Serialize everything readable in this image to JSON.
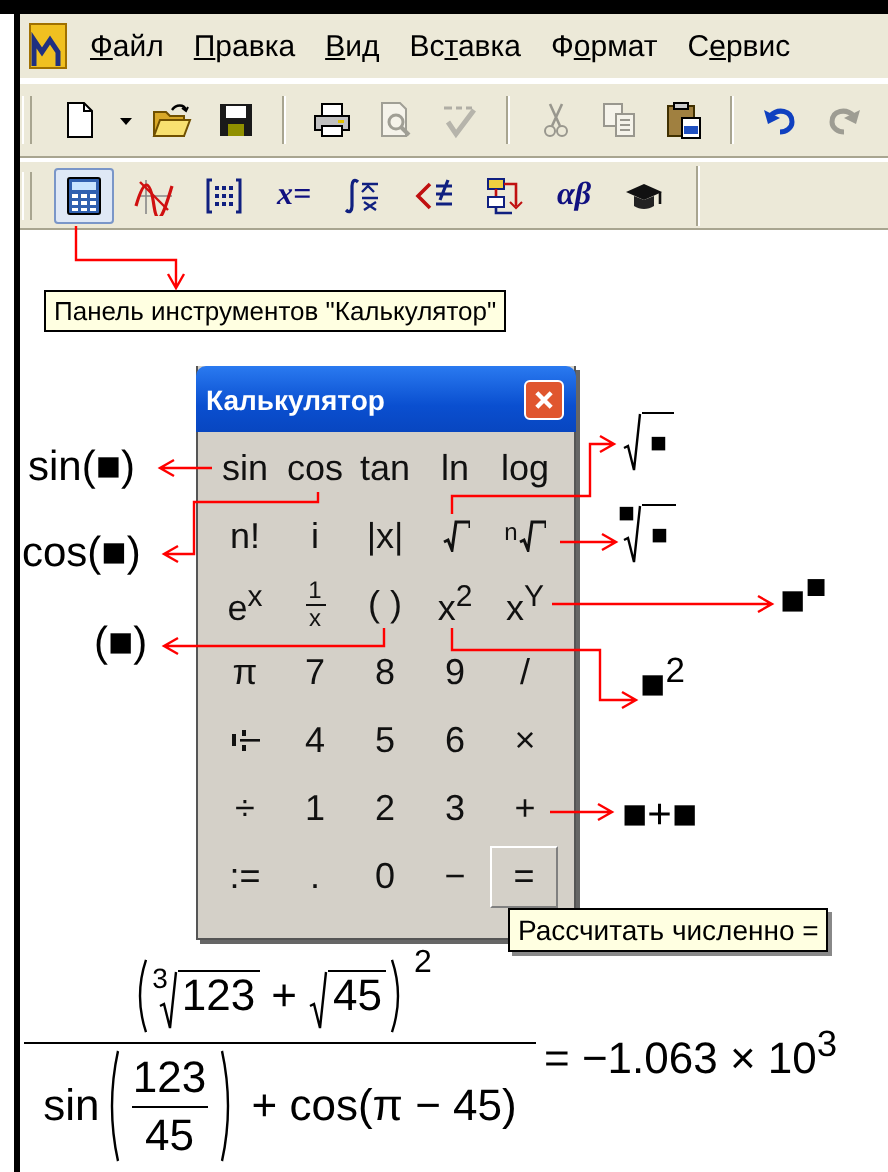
{
  "menu_bar": [
    {
      "mnemonic": "Ф",
      "suffix": "айл"
    },
    {
      "mnemonic": "П",
      "suffix": "равка"
    },
    {
      "mnemonic": "В",
      "suffix": "ид"
    },
    {
      "prefix": "Вс",
      "mnemonic": "т",
      "suffix": "авка"
    },
    {
      "prefix": "Ф",
      "mnemonic": "о",
      "suffix": "рмат"
    },
    {
      "prefix": "С",
      "mnemonic": "е",
      "suffix": "рвис"
    }
  ],
  "standard_toolbar": [
    {
      "kind": "button",
      "disabled": false
    },
    {
      "kind": "button",
      "disabled": false
    },
    {
      "kind": "button",
      "disabled": false
    },
    {
      "kind": "button",
      "disabled": false
    },
    {
      "kind": "separator"
    },
    {
      "kind": "button",
      "disabled": false
    },
    {
      "kind": "button",
      "disabled": true
    },
    {
      "kind": "button",
      "disabled": true
    },
    {
      "kind": "separator"
    },
    {
      "kind": "button",
      "disabled": true
    },
    {
      "kind": "button",
      "disabled": true
    },
    {
      "kind": "button",
      "disabled": false
    },
    {
      "kind": "separator"
    },
    {
      "kind": "button",
      "disabled": false
    },
    {
      "kind": "button",
      "disabled": true
    }
  ],
  "math_toolbar": [
    {
      "kind": "icon",
      "selected": true
    },
    {
      "kind": "icon",
      "selected": false
    },
    {
      "kind": "icon",
      "selected": false
    },
    {
      "kind": "text",
      "label": "x=",
      "selected": false
    },
    {
      "kind": "icon",
      "selected": false
    },
    {
      "kind": "icon",
      "selected": false
    },
    {
      "kind": "icon",
      "selected": false
    },
    {
      "kind": "text",
      "label": "αβ",
      "selected": false
    },
    {
      "kind": "icon",
      "selected": false
    }
  ],
  "toolbar_tooltip": "Панель инструментов \"Калькулятор\"",
  "calculator": {
    "title": "Калькулятор",
    "rows": [
      [
        {
          "kind": "text",
          "label": "sin",
          "hovered": false
        },
        {
          "kind": "text",
          "label": "cos",
          "hovered": false
        },
        {
          "kind": "text",
          "label": "tan",
          "hovered": false
        },
        {
          "kind": "text",
          "label": "ln",
          "hovered": false
        },
        {
          "kind": "text",
          "label": "log",
          "hovered": false
        }
      ],
      [
        {
          "kind": "text",
          "label": "n!",
          "hovered": false
        },
        {
          "kind": "text",
          "label": "i",
          "hovered": false
        },
        {
          "kind": "text",
          "label": "|x|",
          "hovered": false
        },
        {
          "kind": "root",
          "hovered": false
        },
        {
          "kind": "root",
          "index": "n",
          "hovered": false
        }
      ],
      [
        {
          "kind": "text",
          "label": "e$^{x}$",
          "hovered": false
        },
        {
          "kind": "fraction",
          "numerator": "1",
          "denominator": "x",
          "hovered": false
        },
        {
          "kind": "text",
          "label": "( )",
          "hovered": false
        },
        {
          "kind": "text",
          "label": "x$^{2}$",
          "hovered": false
        },
        {
          "kind": "text",
          "label": "x$^{Y}$",
          "hovered": false
        }
      ],
      [
        {
          "kind": "text",
          "label": "π",
          "hovered": false
        },
        {
          "kind": "text",
          "label": "7",
          "hovered": false
        },
        {
          "kind": "text",
          "label": "8",
          "hovered": false
        },
        {
          "kind": "text",
          "label": "9",
          "hovered": false
        },
        {
          "kind": "text",
          "label": "/",
          "hovered": false
        }
      ],
      [
        {
          "kind": "mixed",
          "hovered": false
        },
        {
          "kind": "text",
          "label": "4",
          "hovered": false
        },
        {
          "kind": "text",
          "label": "5",
          "hovered": false
        },
        {
          "kind": "text",
          "label": "6",
          "hovered": false
        },
        {
          "kind": "text",
          "label": "×",
          "hovered": false
        }
      ],
      [
        {
          "kind": "text",
          "label": "÷",
          "hovered": false
        },
        {
          "kind": "text",
          "label": "1",
          "hovered": false
        },
        {
          "kind": "text",
          "label": "2",
          "hovered": false
        },
        {
          "kind": "text",
          "label": "3",
          "hovered": false
        },
        {
          "kind": "text",
          "label": "+",
          "hovered": false
        }
      ],
      [
        {
          "kind": "text",
          "label": ":=",
          "hovered": false
        },
        {
          "kind": "text",
          "label": ".",
          "hovered": false
        },
        {
          "kind": "text",
          "label": "0",
          "hovered": false
        },
        {
          "kind": "text",
          "label": "−",
          "hovered": false
        },
        {
          "kind": "text",
          "label": "=",
          "hovered": true
        }
      ]
    ]
  },
  "button_tooltip": "Рассчитать численно =",
  "annotations": [
    {
      "kind": "text",
      "label": "sin(■)"
    },
    {
      "kind": "text",
      "label": "cos(■)"
    },
    {
      "kind": "text",
      "label": "(■)"
    },
    {
      "kind": "root",
      "radicand": "■"
    },
    {
      "kind": "root",
      "index": "■",
      "radicand": "■"
    },
    {
      "kind": "text",
      "label": "■$^{■}$"
    },
    {
      "kind": "text",
      "label": "■$^{2}$"
    },
    {
      "kind": "text",
      "label": "■+■"
    }
  ],
  "formula": {
    "numerator": {
      "root_index": "3",
      "root1": "123",
      "operator": "+",
      "root2": "45",
      "exponent": "2"
    },
    "denominator": {
      "function": "sin",
      "fraction_numerator": "123",
      "fraction_denominator": "45",
      "rest": "+ cos(π − 45)"
    },
    "result": "= −1.063 × 10$^{3}$"
  }
}
